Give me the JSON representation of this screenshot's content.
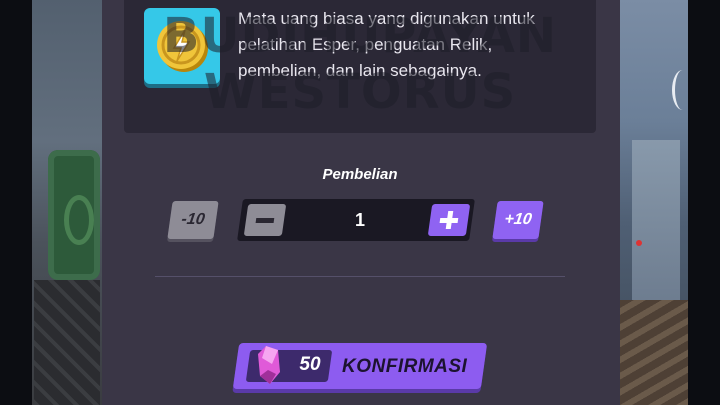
{
  "item": {
    "icon": "gold-coin-icon",
    "description": "Mata uang biasa yang digunakan untuk pelatihan Esper, penguatan Relik, pembelian, dan lain sebagainya."
  },
  "purchase": {
    "label": "Pembelian",
    "minus10_label": "-10",
    "plus10_label": "+10",
    "quantity": "1"
  },
  "confirm": {
    "price": "50",
    "currency_icon": "purple-crystal-icon",
    "label": "KONFIRMASI"
  },
  "watermark": "BUDIHUPAYAN WESTORUS",
  "colors": {
    "accent": "#8f63f2",
    "panel": "#3a3646",
    "card": "#2b2836",
    "coin_tile": "#35c8e8"
  }
}
